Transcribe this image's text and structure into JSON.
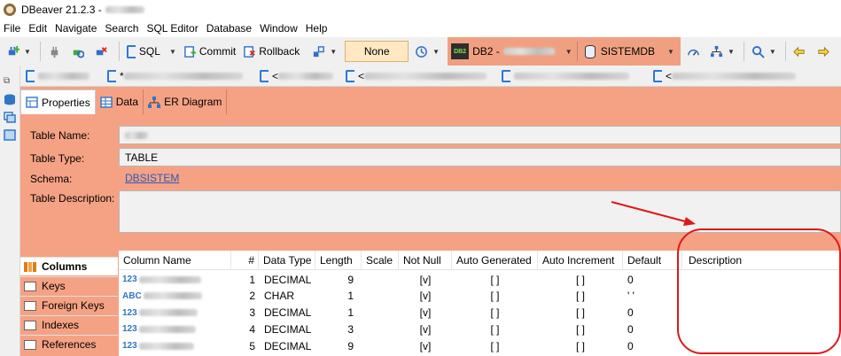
{
  "window": {
    "title": "DBeaver 21.2.3 -"
  },
  "menu": [
    "File",
    "Edit",
    "Navigate",
    "Search",
    "SQL Editor",
    "Database",
    "Window",
    "Help"
  ],
  "toolbar": {
    "sql_label": "SQL",
    "commit_label": "Commit",
    "rollback_label": "Rollback",
    "transaction_mode": "None",
    "connection_label": "DB2 -",
    "database_label": "SISTEMDB"
  },
  "editor_tabs": [
    {
      "label": ""
    },
    {
      "label": "*"
    },
    {
      "label": "<"
    },
    {
      "label": "<"
    },
    {
      "label": ""
    },
    {
      "label": "<"
    }
  ],
  "subtabs": [
    "Properties",
    "Data",
    "ER Diagram"
  ],
  "properties": {
    "table_name_label": "Table Name:",
    "table_name_value": "",
    "table_type_label": "Table Type:",
    "table_type_value": "TABLE",
    "schema_label": "Schema:",
    "schema_value": "DBSISTEM",
    "description_label": "Table Description:"
  },
  "side_nav": [
    {
      "label": "Columns",
      "icon": "columns-icon"
    },
    {
      "label": "Keys",
      "icon": "key-icon"
    },
    {
      "label": "Foreign Keys",
      "icon": "foreign-key-icon"
    },
    {
      "label": "Indexes",
      "icon": "index-icon"
    },
    {
      "label": "References",
      "icon": "reference-icon"
    }
  ],
  "columns_table": {
    "headers": [
      "Column Name",
      "#",
      "Data Type",
      "Length",
      "Scale",
      "Not Null",
      "Auto Generated",
      "Auto Increment",
      "Default",
      "Description"
    ],
    "rows": [
      {
        "type_tag": "123",
        "name": "",
        "num": "1",
        "data_type": "DECIMAL",
        "length": "9",
        "scale": "",
        "not_null": "[v]",
        "auto_generated": "[ ]",
        "auto_increment": "[ ]",
        "default": "0",
        "description": ""
      },
      {
        "type_tag": "ABC",
        "name": "",
        "num": "2",
        "data_type": "CHAR",
        "length": "1",
        "scale": "",
        "not_null": "[v]",
        "auto_generated": "[ ]",
        "auto_increment": "[ ]",
        "default": "' '",
        "description": ""
      },
      {
        "type_tag": "123",
        "name": "",
        "num": "3",
        "data_type": "DECIMAL",
        "length": "1",
        "scale": "",
        "not_null": "[v]",
        "auto_generated": "[ ]",
        "auto_increment": "[ ]",
        "default": "0",
        "description": ""
      },
      {
        "type_tag": "123",
        "name": "",
        "num": "4",
        "data_type": "DECIMAL",
        "length": "3",
        "scale": "",
        "not_null": "[v]",
        "auto_generated": "[ ]",
        "auto_increment": "[ ]",
        "default": "0",
        "description": ""
      },
      {
        "type_tag": "123",
        "name": "",
        "num": "5",
        "data_type": "DECIMAL",
        "length": "9",
        "scale": "",
        "not_null": "[v]",
        "auto_generated": "[ ]",
        "auto_increment": "[ ]",
        "default": "0",
        "description": ""
      }
    ]
  },
  "colors": {
    "connection_bg": "#f5a284",
    "highlight_annotation": "#e01818",
    "link": "#2b5ab8"
  }
}
